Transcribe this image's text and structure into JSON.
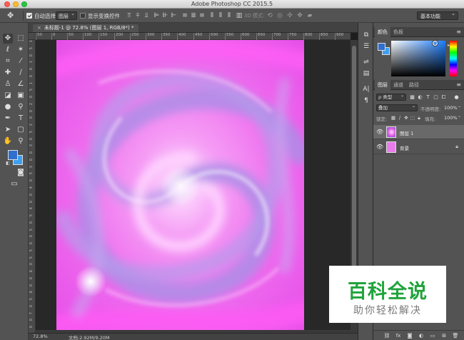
{
  "window": {
    "title": "Adobe Photoshop CC 2015.5"
  },
  "options_bar": {
    "auto_select_label": "自动选择:",
    "auto_select_value": "图层",
    "show_transform_label": "显示变换控件",
    "mode_3d_label": "3D 模式:",
    "workspace": "基本功能"
  },
  "document": {
    "tab_label": "未标题-1 @ 72.8% (图层 1, RGB/8*) *",
    "ruler_h": [
      "50",
      "0",
      "50",
      "100",
      "150",
      "200",
      "250",
      "300",
      "350",
      "400",
      "450",
      "500",
      "550",
      "600",
      "650",
      "700",
      "750",
      "800",
      "850",
      "900"
    ],
    "ruler_v": [
      "1",
      "5",
      "0",
      "1",
      "0",
      "0",
      "1",
      "5",
      "0",
      "2",
      "0",
      "0",
      "2",
      "5",
      "0",
      "3",
      "0",
      "0",
      "3",
      "5",
      "0",
      "4",
      "0",
      "0",
      "4",
      "5",
      "0",
      "5",
      "0",
      "0",
      "5",
      "5",
      "0",
      "6",
      "0",
      "0",
      "6",
      "5",
      "0",
      "7",
      "0",
      "0"
    ],
    "zoom": "72.8%",
    "doc_size": "文档:2.92M/9.20M",
    "canvas_color": "#f06ef0"
  },
  "color_panel": {
    "tabs": [
      "颜色",
      "色板"
    ],
    "foreground": "#2f6fcd",
    "background": "#3e9ff0"
  },
  "layers_panel": {
    "tabs": [
      "图层",
      "通道",
      "路径"
    ],
    "filter_label": "ρ 类型",
    "blend_mode": "叠加",
    "opacity_label": "不透明度:",
    "opacity_value": "100%",
    "lock_label": "锁定:",
    "fill_label": "填充:",
    "fill_value": "100%",
    "layers": [
      {
        "name": "图层 1",
        "selected": true
      },
      {
        "name": "背景",
        "selected": false,
        "locked": true
      }
    ]
  },
  "watermark": {
    "title": "百科全说",
    "subtitle": "助你轻松解决"
  }
}
